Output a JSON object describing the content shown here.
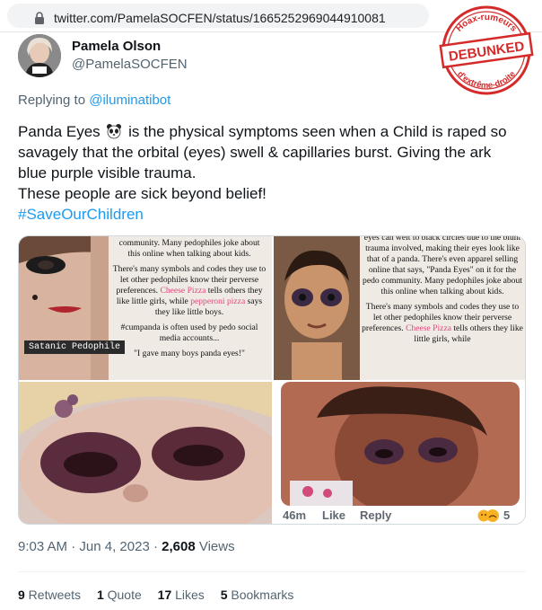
{
  "browser": {
    "url": "twitter.com/PamelaSOCFEN/status/1665252969044910081"
  },
  "stamp": {
    "top": "Hoax-rumeurs",
    "center": "DEBUNKED",
    "bottom": "d'extrême-droite"
  },
  "author": {
    "name": "Pamela Olson",
    "handle": "@PamelaSOCFEN"
  },
  "reply": {
    "prefix": "Replying to ",
    "mention": "@iluminatibot"
  },
  "tweet": {
    "line1_a": "Panda Eyes ",
    "line1_b": " is the physical symptoms seen when a Child is raped so",
    "line2": "savagely that the orbital (eyes) swell & capillaries burst. Giving the ark",
    "line3": "blue purple visible trauma.",
    "line4": "These people are sick beyond belief!",
    "hashtag": "#SaveOurChildren"
  },
  "media": {
    "tile1": {
      "p1": "community. Many pedophiles joke about this online when talking about kids.",
      "p2_a": "There's many symbols and codes they use to let other pedophiles know their perverse preferences. ",
      "p2_pink1": "Cheese Pizza",
      "p2_b": " tells others they like little girls, while ",
      "p2_pink2": "pepperoni pizza",
      "p2_c": " says they like little boys.",
      "p3": "#cumpanda is often used by pedo social media accounts...",
      "p4": "\"I gave many boys panda eyes!\"",
      "label": "Satanic Pedophile"
    },
    "tile2": {
      "p1": "eyes can welt to black circles due to the blunt trauma involved, making their eyes look like that of a panda. There's even apparel selling online that says, \"Panda Eyes\" on it for the pedo community. Many pedophiles joke about this online when talking about kids.",
      "p2_a": "There's many symbols and codes they use to let other pedophiles know their perverse preferences. ",
      "p2_pink": "Cheese Pizza",
      "p2_b": " tells others they like little girls, while"
    },
    "tile4": {
      "time": "46m",
      "like": "Like",
      "reply": "Reply",
      "reaction_count": "5"
    }
  },
  "meta": {
    "time": "9:03 AM",
    "sep": " · ",
    "date": "Jun 4, 2023",
    "views_count": "2,608",
    "views_label": " Views"
  },
  "stats": [
    {
      "count": "9",
      "label": " Retweets"
    },
    {
      "count": "1",
      "label": " Quote"
    },
    {
      "count": "17",
      "label": " Likes"
    },
    {
      "count": "5",
      "label": " Bookmarks"
    }
  ],
  "colors": {
    "link": "#1d9bf0",
    "stamp_red": "#d42a2a"
  }
}
